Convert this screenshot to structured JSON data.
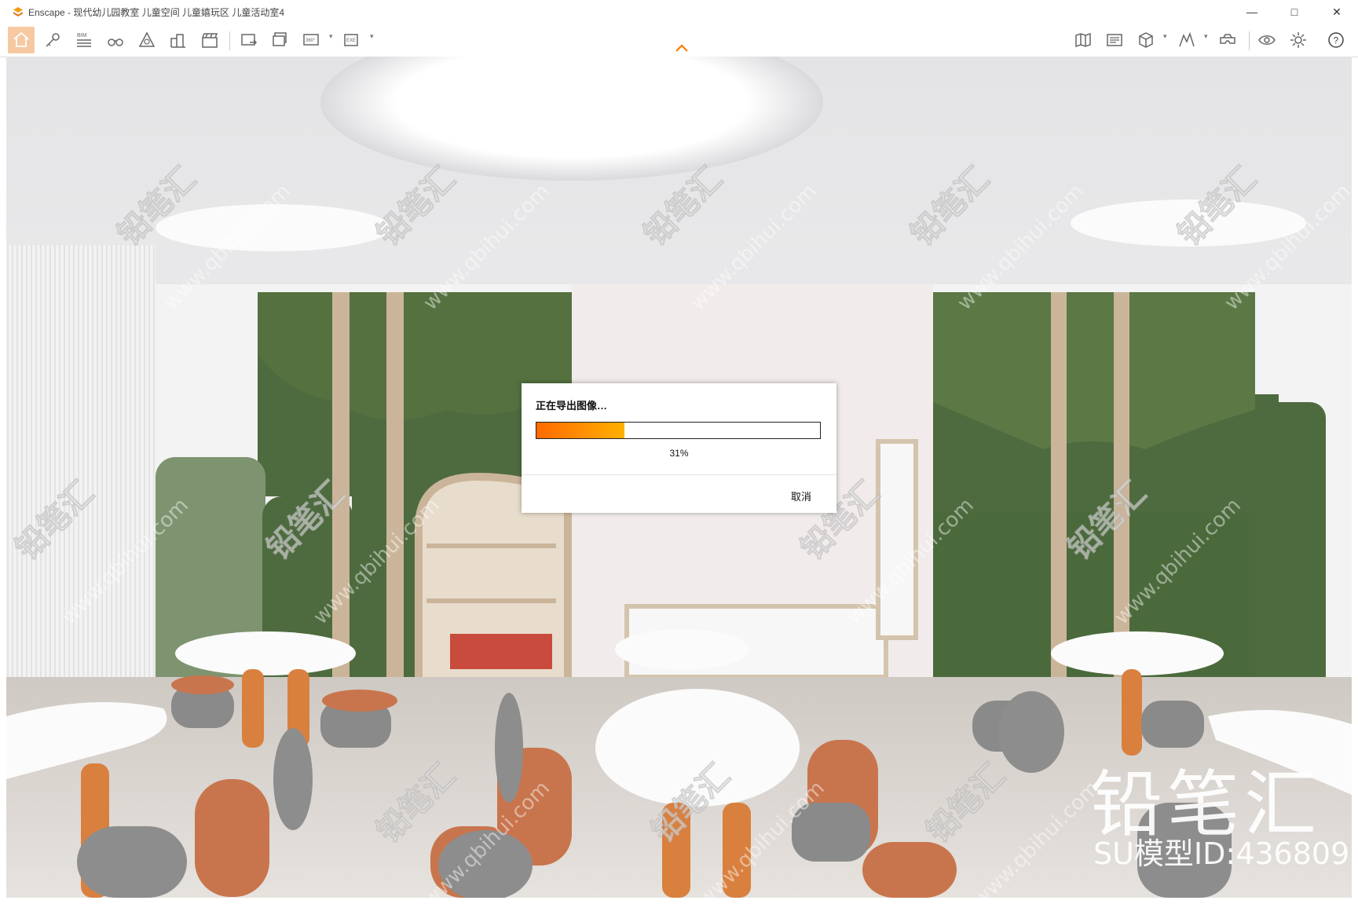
{
  "window": {
    "title": "Enscape - 现代幼儿园教室 儿童空间 儿童嬉玩区 儿童活动室4",
    "controls": {
      "minimize": "—",
      "maximize": "□",
      "close": "✕"
    }
  },
  "toolbar": {
    "bim_label": "BIM",
    "screenshot_label": "360°",
    "exe_label": "EXE",
    "help_label": "?"
  },
  "dialog": {
    "title": "正在导出图像…",
    "progress_fraction": 0.31,
    "progress_text": "31%",
    "cancel_label": "取消"
  },
  "watermark": {
    "brand": "铅笔汇",
    "model_id": "SU模型ID:436809",
    "tile_text": "铅笔汇",
    "tile_url": "www.qbihui.com"
  },
  "colors": {
    "accent": "#ff7a00",
    "wall_green": "#4e6b3f",
    "chair_orange": "#c8754e",
    "chair_gray": "#8d8d8d"
  }
}
